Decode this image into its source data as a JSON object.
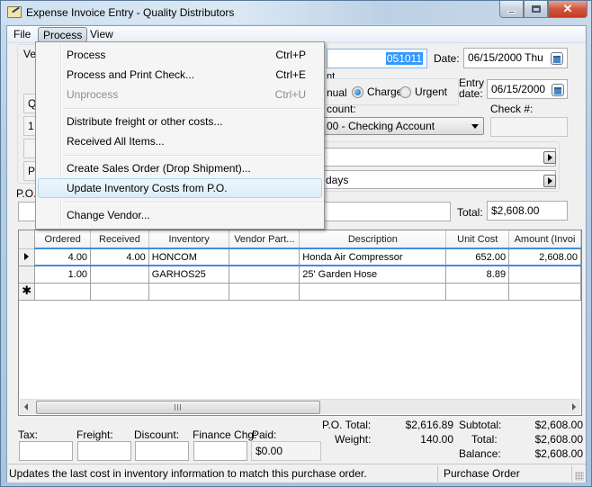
{
  "window": {
    "title": "Expense Invoice Entry - Quality Distributors",
    "controls": {
      "minimize": "minimize",
      "maximize": "maximize",
      "close": "✕"
    }
  },
  "menubar": {
    "items": [
      {
        "label": "File"
      },
      {
        "label": "Process",
        "active": true
      },
      {
        "label": "View"
      }
    ]
  },
  "process_menu": {
    "items": [
      {
        "label": "Process",
        "shortcut": "Ctrl+P",
        "enabled": true
      },
      {
        "label": "Process and Print Check...",
        "shortcut": "Ctrl+E",
        "enabled": true
      },
      {
        "label": "Unprocess",
        "shortcut": "Ctrl+U",
        "enabled": false
      },
      {
        "label": "Distribute freight or other costs...",
        "shortcut": "",
        "enabled": true
      },
      {
        "label": "Received All Items...",
        "shortcut": "",
        "enabled": true
      },
      {
        "label": "Create Sales Order (Drop Shipment)...",
        "shortcut": "",
        "enabled": true
      },
      {
        "label": "Update Inventory Costs from P.O.",
        "shortcut": "",
        "enabled": true,
        "highlighted": true
      },
      {
        "label": "Change Vendor...",
        "shortcut": "",
        "enabled": true
      }
    ]
  },
  "vendor_panel": {
    "label_partial": "Ve",
    "field1_partial": "Q",
    "field2_partial": "1",
    "field4_partial": "P",
    "po_label": "P.O."
  },
  "invoice": {
    "invoice_number": "051011",
    "date_label": "Date:",
    "date": "06/15/2000 Thu",
    "entry_date_label_line1": "Entry",
    "entry_date_label_line2": "date:",
    "entry_date": "06/15/2000",
    "payment_group_label_partial": "nt",
    "payment_options": [
      {
        "label": "nual",
        "selected": false,
        "partial": true
      },
      {
        "label": "Charge",
        "selected": true
      },
      {
        "label": "Urgent",
        "selected": false
      }
    ],
    "account_label_partial": "count:",
    "account_value_partial": "00 - Checking Account",
    "check_label": "Check #:",
    "check_value": "",
    "lookup1_value": "",
    "terms_value_partial": "days",
    "po_field_value": "",
    "total_label": "Total:",
    "total_value": "$2,608.00"
  },
  "grid": {
    "columns": [
      "Ordered",
      "Received",
      "Inventory",
      "Vendor Part...",
      "Description",
      "Unit Cost",
      "Amount (Invoi"
    ],
    "rows": [
      {
        "ordered": "4.00",
        "received": "4.00",
        "inventory": "HONCOM",
        "vendor_part": "",
        "description": "Honda Air Compressor",
        "unit_cost": "652.00",
        "amount": "2,608.00",
        "current": true
      },
      {
        "ordered": "1.00",
        "received": "",
        "inventory": "GARHOS25",
        "vendor_part": "",
        "description": "25' Garden Hose",
        "unit_cost": "8.89",
        "amount": ""
      }
    ],
    "new_row_marker": "✱"
  },
  "footer": {
    "tax_label": "Tax:",
    "tax_value": "",
    "freight_label": "Freight:",
    "freight_value": "",
    "discount_label": "Discount:",
    "discount_value": "",
    "finance_label": "Finance Chg:",
    "finance_value": "",
    "paid_label": "Paid:",
    "paid_value": "$0.00",
    "po_total_label": "P.O. Total:",
    "po_total_value": "$2,616.89",
    "weight_label": "Weight:",
    "weight_value": "140.00",
    "subtotal_label": "Subtotal:",
    "subtotal_value": "$2,608.00",
    "total_label": "Total:",
    "total_value": "$2,608.00",
    "balance_label": "Balance:",
    "balance_value": "$2,608.00"
  },
  "statusbar": {
    "message": "Updates the last cost in inventory information to match this purchase order.",
    "mode": "Purchase Order"
  }
}
